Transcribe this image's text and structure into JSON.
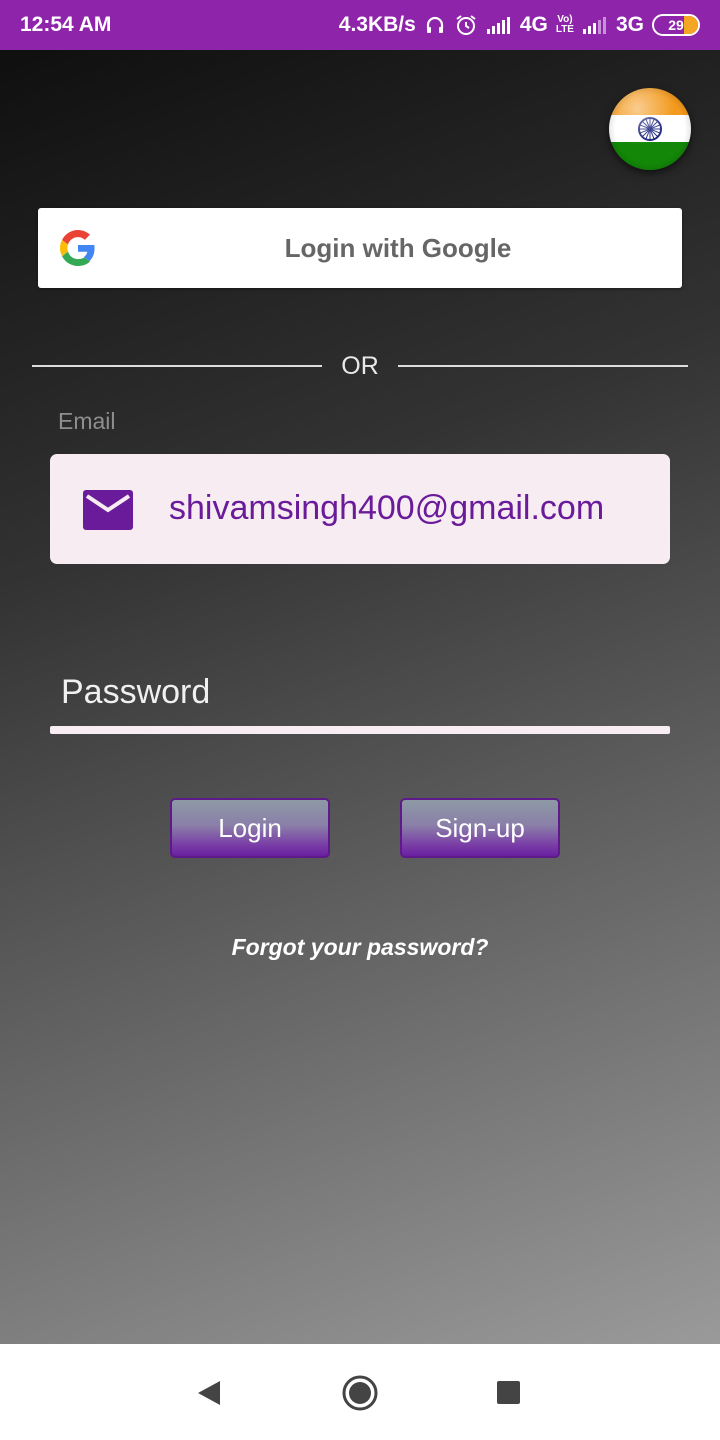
{
  "status_bar": {
    "time": "12:54 AM",
    "speed": "4.3KB/s",
    "net1": "4G",
    "volte_top": "Vo)",
    "volte_bottom": "LTE",
    "net2": "3G",
    "battery": "29",
    "icons": [
      "headset-icon",
      "alarm-icon",
      "signal-icon",
      "signal-icon"
    ]
  },
  "flag": {
    "icon": "india-flag-icon"
  },
  "google": {
    "label": "Login with Google",
    "icon": "google-icon"
  },
  "divider": {
    "text": "OR"
  },
  "email": {
    "label": "Email",
    "value": "shivamsingh400@gmail.com",
    "icon": "mail-icon"
  },
  "password": {
    "placeholder": "Password"
  },
  "buttons": {
    "login": "Login",
    "signup": "Sign-up"
  },
  "forgot": "Forgot your password?",
  "nav": {
    "icons": [
      "back-icon",
      "home-icon",
      "recents-icon"
    ]
  },
  "colors": {
    "status_bar": "#8e24aa",
    "accent": "#6a1b9a",
    "email_bg": "#f6ecf1"
  }
}
